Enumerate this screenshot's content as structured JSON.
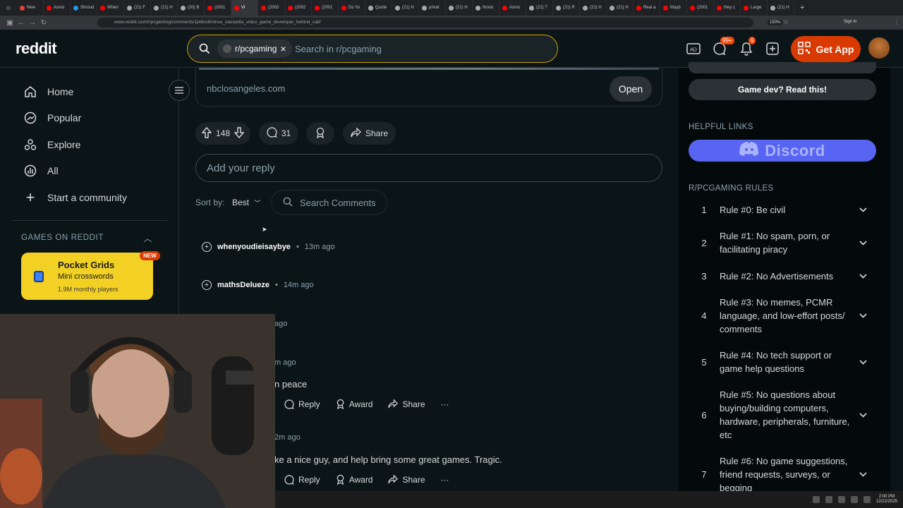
{
  "browser": {
    "tabs": [
      "New",
      "Asmo",
      "Shroud",
      "When",
      "(21) F",
      "(21) H",
      "(20) B",
      "(2001",
      "Vi",
      "(2002",
      "(2002",
      "(2001",
      "Do Yo",
      "Quote",
      "(21) H",
      "privat",
      "(21) H",
      "Noxio",
      "Asmo",
      "(21) T",
      "(21) R",
      "(21) H",
      "(21) H",
      "Real a",
      "Mayb",
      "(2001",
      "they c",
      "Large",
      "(21) H"
    ],
    "active_tab_index": 8,
    "url": "www.reddit.com/r/pcgaming/comments/1pt8sn6/vince_zampella_video_game_developer_behind_call/",
    "zoom": "150%",
    "signin_label": "Sign in"
  },
  "header": {
    "logo": "reddit",
    "search_chip": "r/pcgaming",
    "search_placeholder": "Search in r/pcgaming",
    "chat_badge": "99+",
    "notif_badge": "6",
    "get_app": "Get App"
  },
  "leftnav": {
    "items": [
      {
        "label": "Home",
        "icon": "home-icon"
      },
      {
        "label": "Popular",
        "icon": "popular-icon"
      },
      {
        "label": "Explore",
        "icon": "explore-icon"
      },
      {
        "label": "All",
        "icon": "all-icon"
      },
      {
        "label": "Start a community",
        "icon": "plus-icon"
      }
    ],
    "games_heading": "GAMES ON REDDIT",
    "game_card": {
      "title": "Pocket Grids",
      "subtitle": "Mini crosswords",
      "players": "1.9M monthly players",
      "badge": "NEW"
    }
  },
  "post": {
    "link_domain": "nbclosangeles.com",
    "open_label": "Open",
    "votes": "148",
    "comments": "31",
    "share_label": "Share",
    "reply_placeholder": "Add your reply",
    "sort_label": "Sort by:",
    "sort_value": "Best",
    "search_comments": "Search Comments"
  },
  "comments": [
    {
      "user": "whenyoudieisaybye",
      "time": "13m ago"
    },
    {
      "user": "mathsDelueze",
      "time": "14m ago"
    },
    {
      "user": "",
      "time": "ago"
    },
    {
      "user": "",
      "time": "m ago",
      "text": "n peace"
    },
    {
      "user": "",
      "time": "2m ago",
      "text": "ke a nice guy, and help bring some great games. Tragic."
    }
  ],
  "comment_actions": {
    "reply": "Reply",
    "award": "Award",
    "share": "Share",
    "more": "···"
  },
  "rightbar": {
    "gamedev_button": "Game dev? Read this!",
    "helpful_links_heading": "HELPFUL LINKS",
    "discord_label": "Discord",
    "rules_heading": "R/PCGAMING RULES",
    "rules": [
      {
        "num": "1",
        "text": "Rule #0: Be civil"
      },
      {
        "num": "2",
        "text": "Rule #1: No spam, porn, or facilitating piracy"
      },
      {
        "num": "3",
        "text": "Rule #2: No Advertisements"
      },
      {
        "num": "4",
        "text": "Rule #3: No memes, PCMR language, and low-effort posts/ comments"
      },
      {
        "num": "5",
        "text": "Rule #4: No tech support or game help questions"
      },
      {
        "num": "6",
        "text": "Rule #5: No questions about buying/building computers, hardware, peripherals, furniture, etc"
      },
      {
        "num": "7",
        "text": "Rule #6: No game suggestions, friend requests, surveys, or begging"
      }
    ]
  },
  "taskbar": {
    "time": "2:00 PM",
    "date": "12/22/2025"
  },
  "colors": {
    "background": "#0b1416",
    "accent": "#ff4500",
    "discord": "#5865f2",
    "search_border": "#c9a100"
  }
}
